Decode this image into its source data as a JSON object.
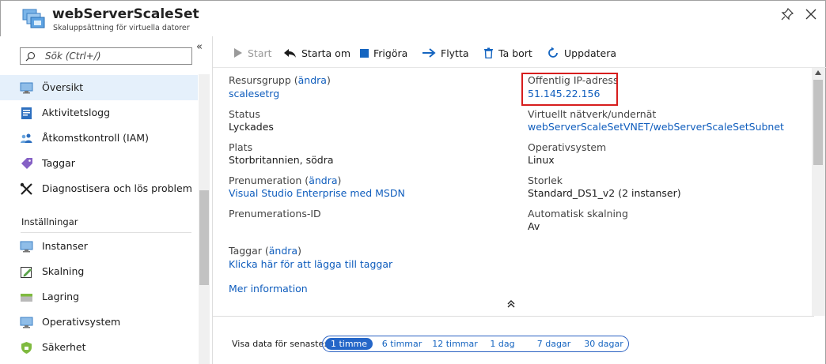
{
  "header": {
    "title": "webServerScaleSet",
    "subtitle": "Skaluppsättning för virtuella datorer"
  },
  "sidebar": {
    "search_placeholder": "Sök (Ctrl+/)",
    "collapse_label": "«",
    "items": [
      {
        "label": "Översikt",
        "icon": "overview-icon"
      },
      {
        "label": "Aktivitetslogg",
        "icon": "activity-log-icon"
      },
      {
        "label": "Åtkomstkontroll (IAM)",
        "icon": "people-icon"
      },
      {
        "label": "Taggar",
        "icon": "tag-icon"
      },
      {
        "label": "Diagnostisera och lös problem",
        "icon": "wrench-icon"
      }
    ],
    "section_label": "Inställningar",
    "settings_items": [
      {
        "label": "Instanser",
        "icon": "monitor-icon"
      },
      {
        "label": "Skalning",
        "icon": "edit-scale-icon"
      },
      {
        "label": "Lagring",
        "icon": "storage-icon"
      },
      {
        "label": "Operativsystem",
        "icon": "os-icon"
      },
      {
        "label": "Säkerhet",
        "icon": "shield-icon"
      }
    ]
  },
  "toolbar": {
    "start": "Start",
    "restart": "Starta om",
    "deallocate": "Frigöra",
    "move": "Flytta",
    "delete": "Ta bort",
    "refresh": "Uppdatera"
  },
  "essentials": {
    "left": [
      {
        "label": "Resursgrupp",
        "change": "ändra",
        "value": "scalesetrg",
        "value_is_link": true
      },
      {
        "label": "Status",
        "value": "Lyckades"
      },
      {
        "label": "Plats",
        "value": "Storbritannien, södra"
      },
      {
        "label": "Prenumeration",
        "change": "ändra",
        "value": "Visual Studio Enterprise med MSDN",
        "value_is_link": true
      },
      {
        "label": "Prenumerations-ID",
        "value": ""
      }
    ],
    "right": [
      {
        "label": "Offentlig IP-adress",
        "value": "51.145.22.156",
        "value_is_link": true
      },
      {
        "label": "Virtuellt nätverk/undernät",
        "value": "webServerScaleSetVNET/webServerScaleSetSubnet",
        "value_is_link": true
      },
      {
        "label": "Operativsystem",
        "value": "Linux"
      },
      {
        "label": "Storlek",
        "value": "Standard_DS1_v2 (2 instanser)"
      },
      {
        "label": "Automatisk skalning",
        "value": "Av"
      }
    ],
    "tags_label": "Taggar",
    "tags_change": "ändra",
    "tags_link": "Klicka här för att lägga till taggar",
    "more_info": "Mer information"
  },
  "time_range": {
    "label": "Visa data för senaste:",
    "options": [
      "1 timme",
      "6 timmar",
      "12 timmar",
      "1 dag",
      "7 dagar",
      "30 dagar"
    ],
    "selected": "1 timme"
  },
  "colors": {
    "link": "#0f5dbd",
    "highlight": "#d71d1d",
    "selected_nav": "#e5f0fb",
    "accent": "#2466c8"
  }
}
